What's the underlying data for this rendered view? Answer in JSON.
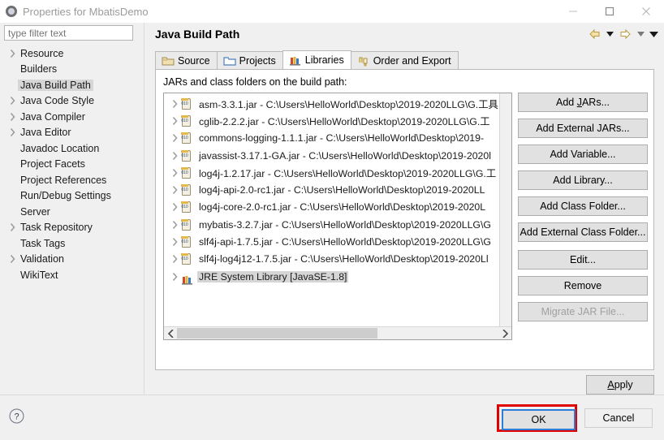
{
  "window": {
    "title": "Properties for MbatisDemo",
    "icon": "eclipse-icon",
    "controls": {
      "minimize": "minimize-icon",
      "maximize": "maximize-icon",
      "close": "close-icon"
    }
  },
  "sidebar": {
    "filter": {
      "value": "",
      "placeholder": "type filter text"
    },
    "items": [
      {
        "label": "Resource",
        "expandable": true,
        "selected": false
      },
      {
        "label": "Builders",
        "expandable": false,
        "selected": false
      },
      {
        "label": "Java Build Path",
        "expandable": false,
        "selected": true
      },
      {
        "label": "Java Code Style",
        "expandable": true,
        "selected": false
      },
      {
        "label": "Java Compiler",
        "expandable": true,
        "selected": false
      },
      {
        "label": "Java Editor",
        "expandable": true,
        "selected": false
      },
      {
        "label": "Javadoc Location",
        "expandable": false,
        "selected": false
      },
      {
        "label": "Project Facets",
        "expandable": false,
        "selected": false
      },
      {
        "label": "Project References",
        "expandable": false,
        "selected": false
      },
      {
        "label": "Run/Debug Settings",
        "expandable": false,
        "selected": false
      },
      {
        "label": "Server",
        "expandable": false,
        "selected": false
      },
      {
        "label": "Task Repository",
        "expandable": true,
        "selected": false
      },
      {
        "label": "Task Tags",
        "expandable": false,
        "selected": false
      },
      {
        "label": "Validation",
        "expandable": true,
        "selected": false
      },
      {
        "label": "WikiText",
        "expandable": false,
        "selected": false
      }
    ]
  },
  "page": {
    "title": "Java Build Path",
    "nav": {
      "back": "back-arrow-icon",
      "back_menu": "chevron-down-icon",
      "forward": "forward-arrow-icon",
      "forward_menu": "chevron-down-icon",
      "view_menu": "chevron-down-icon"
    },
    "tabs": [
      {
        "label": "Source",
        "icon": "source-folder-icon",
        "active": false
      },
      {
        "label": "Projects",
        "icon": "projects-folder-icon",
        "active": false
      },
      {
        "label": "Libraries",
        "icon": "libraries-icon",
        "active": true
      },
      {
        "label": "Order and Export",
        "icon": "order-export-icon",
        "active": false
      }
    ],
    "list_label": "JARs and class folders on the build path:",
    "entries": [
      {
        "name": "asm-3.3.1.jar",
        "path": "C:\\Users\\HelloWorld\\Desktop\\2019-2020LLG\\G.工具",
        "icon": "jar-icon",
        "selected": false
      },
      {
        "name": "cglib-2.2.2.jar",
        "path": "C:\\Users\\HelloWorld\\Desktop\\2019-2020LLG\\G.工",
        "icon": "jar-icon",
        "selected": false
      },
      {
        "name": "commons-logging-1.1.1.jar",
        "path": "C:\\Users\\HelloWorld\\Desktop\\2019-",
        "icon": "jar-icon",
        "selected": false
      },
      {
        "name": "javassist-3.17.1-GA.jar",
        "path": "C:\\Users\\HelloWorld\\Desktop\\2019-2020l",
        "icon": "jar-icon",
        "selected": false
      },
      {
        "name": "log4j-1.2.17.jar",
        "path": "C:\\Users\\HelloWorld\\Desktop\\2019-2020LLG\\G.工",
        "icon": "jar-icon",
        "selected": false
      },
      {
        "name": "log4j-api-2.0-rc1.jar",
        "path": "C:\\Users\\HelloWorld\\Desktop\\2019-2020LL",
        "icon": "jar-icon",
        "selected": false
      },
      {
        "name": "log4j-core-2.0-rc1.jar",
        "path": "C:\\Users\\HelloWorld\\Desktop\\2019-2020L",
        "icon": "jar-icon",
        "selected": false
      },
      {
        "name": "mybatis-3.2.7.jar",
        "path": "C:\\Users\\HelloWorld\\Desktop\\2019-2020LLG\\G",
        "icon": "jar-icon",
        "selected": false
      },
      {
        "name": "slf4j-api-1.7.5.jar",
        "path": "C:\\Users\\HelloWorld\\Desktop\\2019-2020LLG\\G",
        "icon": "jar-icon",
        "selected": false
      },
      {
        "name": "slf4j-log4j12-1.7.5.jar",
        "path": "C:\\Users\\HelloWorld\\Desktop\\2019-2020Ll",
        "icon": "jar-icon",
        "selected": false
      },
      {
        "name": "JRE System Library [JavaSE-1.8]",
        "path": "",
        "icon": "library-icon",
        "selected": true
      }
    ],
    "side_buttons": [
      {
        "label": "Add JARs...",
        "mnemonic": "J",
        "enabled": true
      },
      {
        "label": "Add External JARs...",
        "mnemonic": "",
        "enabled": true
      },
      {
        "label": "Add Variable...",
        "mnemonic": "",
        "enabled": true
      },
      {
        "label": "Add Library...",
        "mnemonic": "",
        "enabled": true
      },
      {
        "label": "Add Class Folder...",
        "mnemonic": "",
        "enabled": true
      },
      {
        "label": "Add External Class Folder...",
        "mnemonic": "",
        "enabled": true
      },
      {
        "label": "Edit...",
        "mnemonic": "",
        "enabled": true
      },
      {
        "label": "Remove",
        "mnemonic": "",
        "enabled": true
      },
      {
        "label": "Migrate JAR File...",
        "mnemonic": "",
        "enabled": false
      }
    ],
    "scrollbar": {
      "horizontal_left": "left-arrow-icon",
      "horizontal_right": "right-arrow-icon"
    }
  },
  "footer": {
    "help": "help-icon",
    "apply_label": "Apply",
    "apply_mnemonic": "A",
    "ok_label": "OK",
    "cancel_label": "Cancel",
    "highlight_color": "#e00000",
    "focus_color": "#2d7cd6"
  }
}
